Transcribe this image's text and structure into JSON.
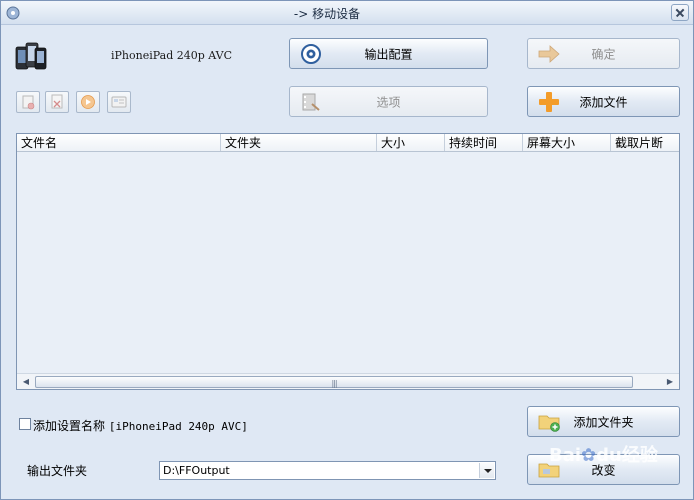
{
  "window": {
    "title": "-> 移动设备"
  },
  "profile": {
    "label": "iPhoneiPad 240p AVC"
  },
  "buttons": {
    "output_config": "输出配置",
    "ok": "确定",
    "options": "选项",
    "add_file": "添加文件",
    "add_folder": "添加文件夹",
    "change": "改变"
  },
  "file_list": {
    "columns": [
      "文件名",
      "文件夹",
      "大小",
      "持续时间",
      "屏幕大小",
      "截取片断"
    ],
    "rows": []
  },
  "add_setting_name": {
    "checked": false,
    "label": "添加设置名称",
    "value": "[iPhoneiPad 240p AVC]"
  },
  "output_folder": {
    "label": "输出文件夹",
    "value": "D:\\FFOutput"
  },
  "watermark": {
    "brand_a": "Bai",
    "brand_b": "du",
    "suffix": "经验"
  },
  "colors": {
    "window_bg": "#dfe8f4",
    "accent_orange": "#f39c2a",
    "list_bg": "#e9eff7"
  }
}
